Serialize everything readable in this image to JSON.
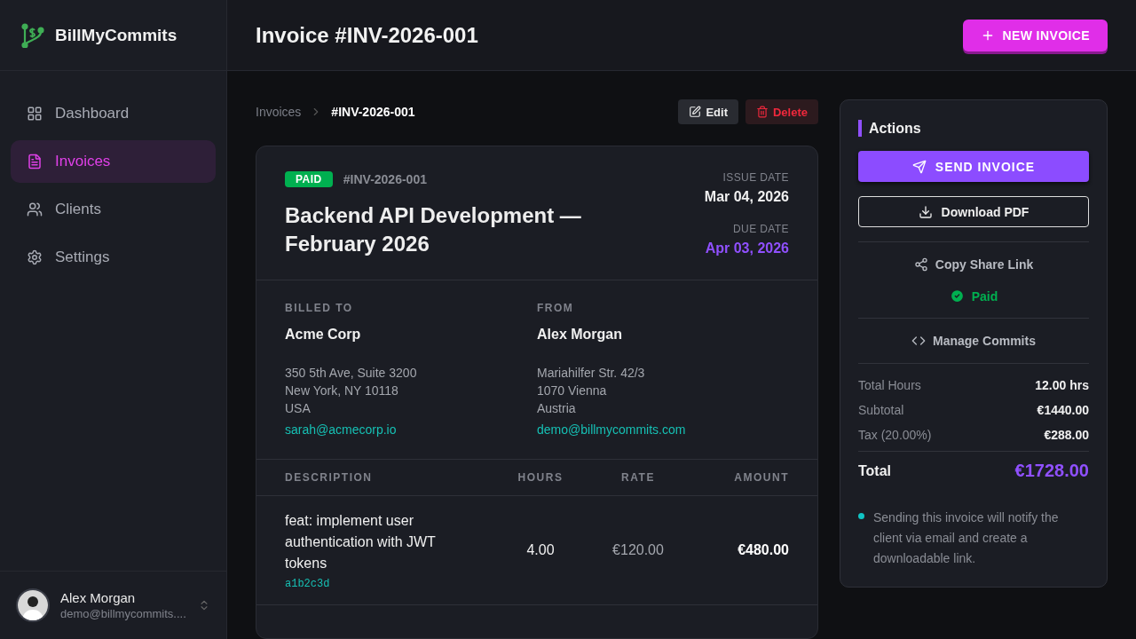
{
  "app": {
    "name": "BillMyCommits"
  },
  "nav": [
    {
      "label": "Dashboard",
      "selected": false
    },
    {
      "label": "Invoices",
      "selected": true
    },
    {
      "label": "Clients",
      "selected": false
    },
    {
      "label": "Settings",
      "selected": false
    }
  ],
  "user": {
    "name": "Alex Morgan",
    "email": "demo@billmycommits...."
  },
  "header": {
    "title": "Invoice #INV-2026-001",
    "new_button": "NEW INVOICE"
  },
  "breadcrumb": [
    {
      "label": "Invoices",
      "selected": false
    },
    {
      "label": "#INV-2026-001",
      "selected": true
    }
  ],
  "toolbar": {
    "edit": "Edit",
    "delete": "Delete"
  },
  "invoice": {
    "status": {
      "label": "PAID",
      "kind": "paid"
    },
    "number": "#INV-2026-001",
    "title": "Backend API Development — February 2026",
    "issue_label": "ISSUE DATE",
    "issue_date": "Mar 04, 2026",
    "due_label": "DUE DATE",
    "due_date": "Apr 03, 2026"
  },
  "parties": [
    {
      "label": "BILLED TO",
      "name": "Acme Corp",
      "address": [
        "350 5th Ave, Suite 3200",
        "New York, NY 10118",
        "USA"
      ],
      "email": "sarah@acmecorp.io"
    },
    {
      "label": "FROM",
      "name": "Alex Morgan",
      "address": [
        "Mariahilfer Str. 42/3",
        "1070 Vienna",
        "Austria"
      ],
      "email": "demo@billmycommits.com"
    }
  ],
  "table": {
    "columns": [
      "DESCRIPTION",
      "HOURS",
      "RATE",
      "AMOUNT"
    ],
    "rows": [
      {
        "description": "feat: implement user authentication with JWT tokens",
        "commit": "a1b2c3d",
        "hours": "4.00",
        "rate": "€120.00",
        "amount": "€480.00"
      }
    ]
  },
  "actions": {
    "title": "Actions",
    "send": "SEND INVOICE",
    "download": "Download PDF",
    "share": "Copy Share Link",
    "status": {
      "label": "Paid",
      "kind": "paid"
    },
    "manage": "Manage Commits"
  },
  "summary": {
    "rows": [
      {
        "label": "Total Hours",
        "value": "12.00 hrs"
      },
      {
        "label": "Subtotal",
        "value": "€1440.00"
      },
      {
        "label": "Tax (20.00%)",
        "value": "€288.00"
      }
    ],
    "total": {
      "label": "Total",
      "value": "€1728.00"
    },
    "note": "Sending this invoice will notify the client via email and create a downloadable link."
  }
}
